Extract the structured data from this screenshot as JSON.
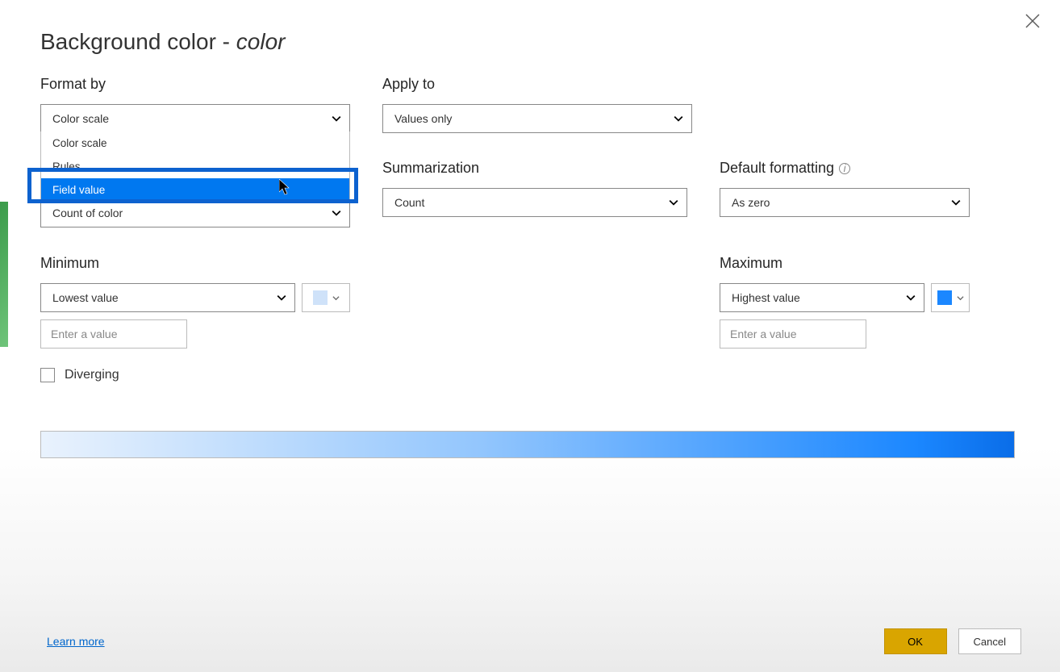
{
  "title": {
    "main": "Background color",
    "separator": " - ",
    "field": "color"
  },
  "close_label": "Close",
  "format_by": {
    "label": "Format by",
    "selected": "Color scale",
    "options": [
      "Color scale",
      "Rules",
      "Field value"
    ],
    "highlighted_option": "Field value"
  },
  "apply_to": {
    "label": "Apply to",
    "selected": "Values only"
  },
  "based_on_field": {
    "selected": "Count of color"
  },
  "summarization": {
    "label": "Summarization",
    "selected": "Count"
  },
  "default_formatting": {
    "label": "Default formatting",
    "selected": "As zero"
  },
  "minimum": {
    "label": "Minimum",
    "selected": "Lowest value",
    "placeholder": "Enter a value",
    "swatch_color": "#cfe2f9"
  },
  "maximum": {
    "label": "Maximum",
    "selected": "Highest value",
    "placeholder": "Enter a value",
    "swatch_color": "#1b87ff"
  },
  "diverging": {
    "label": "Diverging",
    "checked": false
  },
  "footer": {
    "learn_more": "Learn more",
    "ok": "OK",
    "cancel": "Cancel"
  }
}
